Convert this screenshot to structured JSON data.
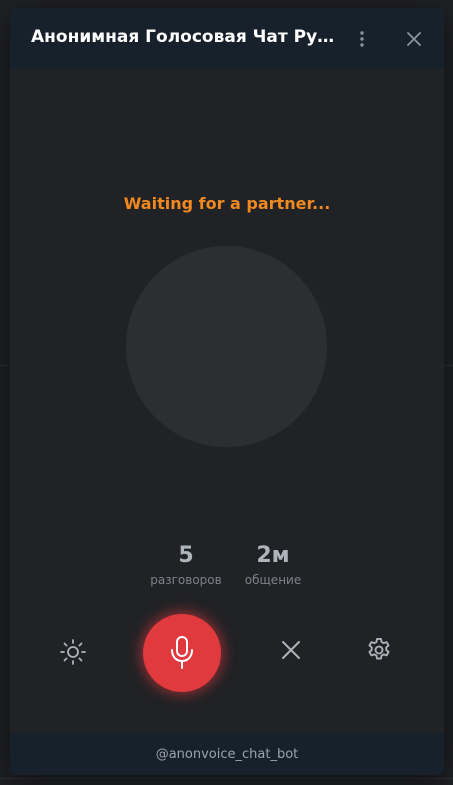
{
  "window": {
    "title": "Анонимная Голосовая Чат Рулетка",
    "menu_icon": "more-vert-icon",
    "close_icon": "close-icon"
  },
  "status_text": "Waiting for a partner...",
  "stats": [
    {
      "value": "5",
      "label": "разговоров"
    },
    {
      "value": "2м",
      "label": "общение"
    }
  ],
  "controls": {
    "theme_icon": "sun-icon",
    "mic_icon": "microphone-icon",
    "skip_icon": "close-icon",
    "settings_icon": "gear-icon"
  },
  "footer_text": "@anonvoice_chat_bot",
  "colors": {
    "accent_orange": "#f0891f",
    "mic_red": "#e0393e",
    "header_bg": "#17212b",
    "panel_bg": "#212225"
  }
}
